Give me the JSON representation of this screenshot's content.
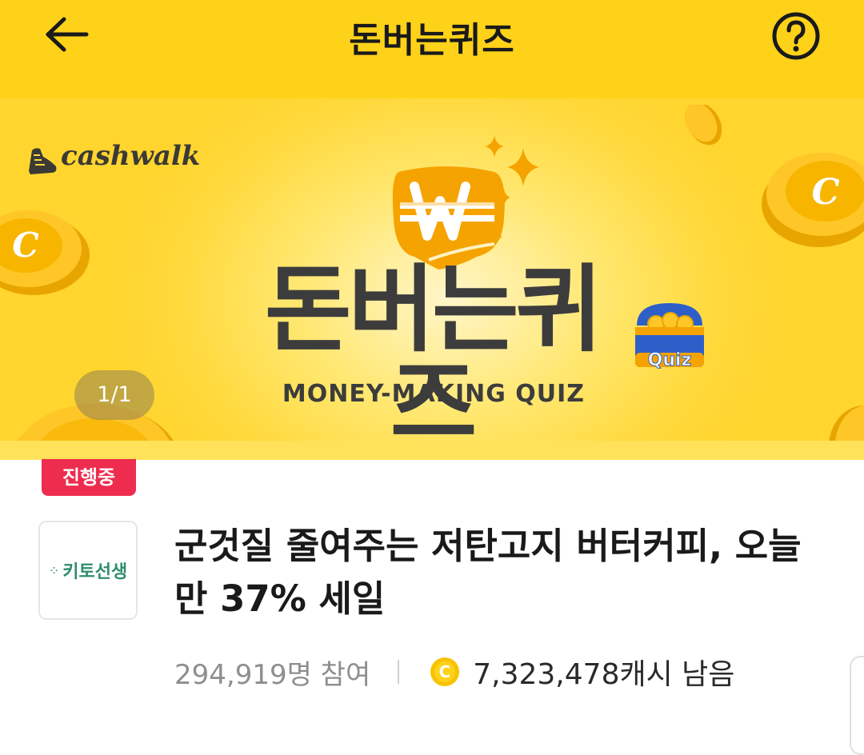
{
  "header": {
    "title": "돈버는퀴즈"
  },
  "banner": {
    "brand": "cashwalk",
    "title": "돈버는퀴즈",
    "subtitle": "MONEY-MAKING QUIZ",
    "chest_label": "Quiz",
    "slide_indicator": "1/1",
    "coin_letter": "C",
    "colors": {
      "yellow": "#ffd21a",
      "coin": "#f7b500",
      "ink": "#3d3c3c"
    }
  },
  "quiz": {
    "status": "진행중",
    "advertiser": "키토선생",
    "title": "군것질 줄여주는 저탄고지 버터커피, 오늘만 37% 세일",
    "participants": "294,919명 참여",
    "cash_remaining": "7,323,478캐시 남음",
    "cash_icon_letter": "C",
    "badge_color": "#ee2c4e"
  }
}
